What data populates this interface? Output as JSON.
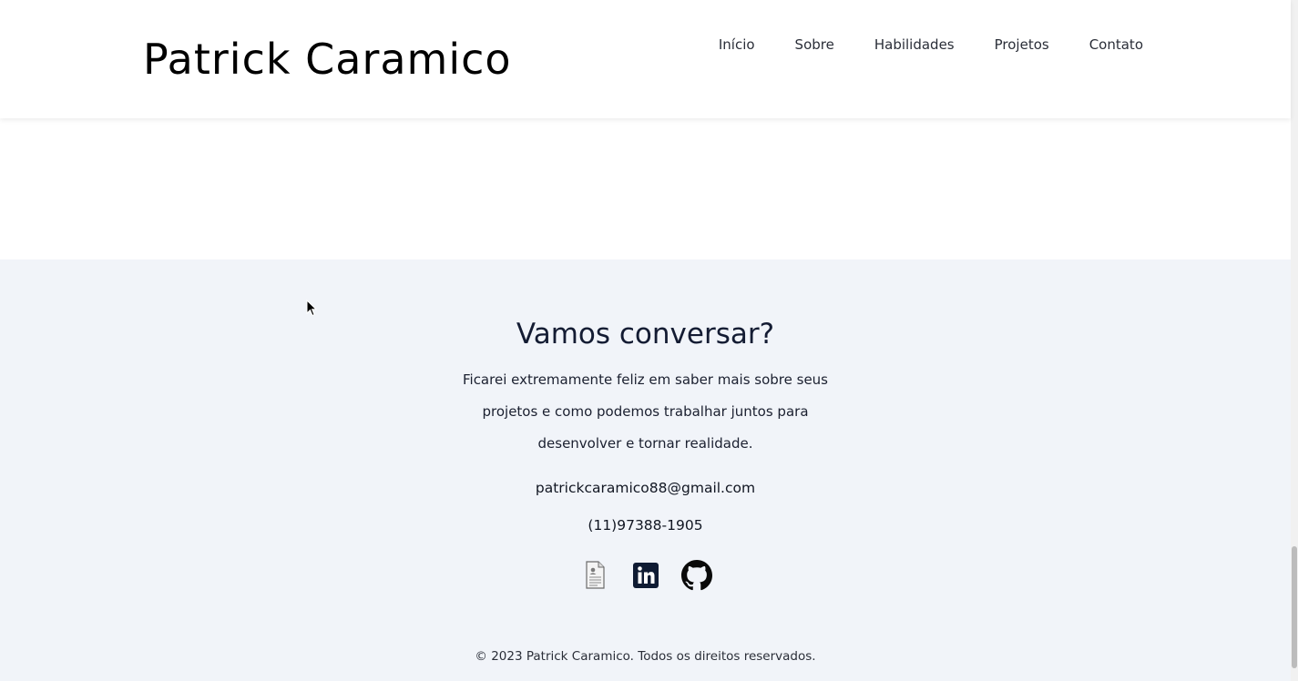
{
  "header": {
    "logo": "Patrick Caramico",
    "nav": [
      {
        "label": "Início"
      },
      {
        "label": "Sobre"
      },
      {
        "label": "Habilidades"
      },
      {
        "label": "Projetos"
      },
      {
        "label": "Contato"
      }
    ]
  },
  "contact": {
    "title": "Vamos conversar?",
    "text": "Ficarei extremamente feliz em saber mais sobre seus projetos e como podemos trabalhar juntos para desenvolver e tornar realidade.",
    "email": "patrickcaramico88@gmail.com",
    "phone": "(11)97388-1905",
    "social_icons": [
      "resume-document-icon",
      "linkedin-icon",
      "github-icon"
    ]
  },
  "footer": {
    "copyright": "© 2023 Patrick Caramico. Todos os direitos reservados."
  },
  "colors": {
    "background": "#ffffff",
    "contact_background": "#f1f4f9",
    "title": "#141c33",
    "linkedin": "#0f1b33"
  }
}
